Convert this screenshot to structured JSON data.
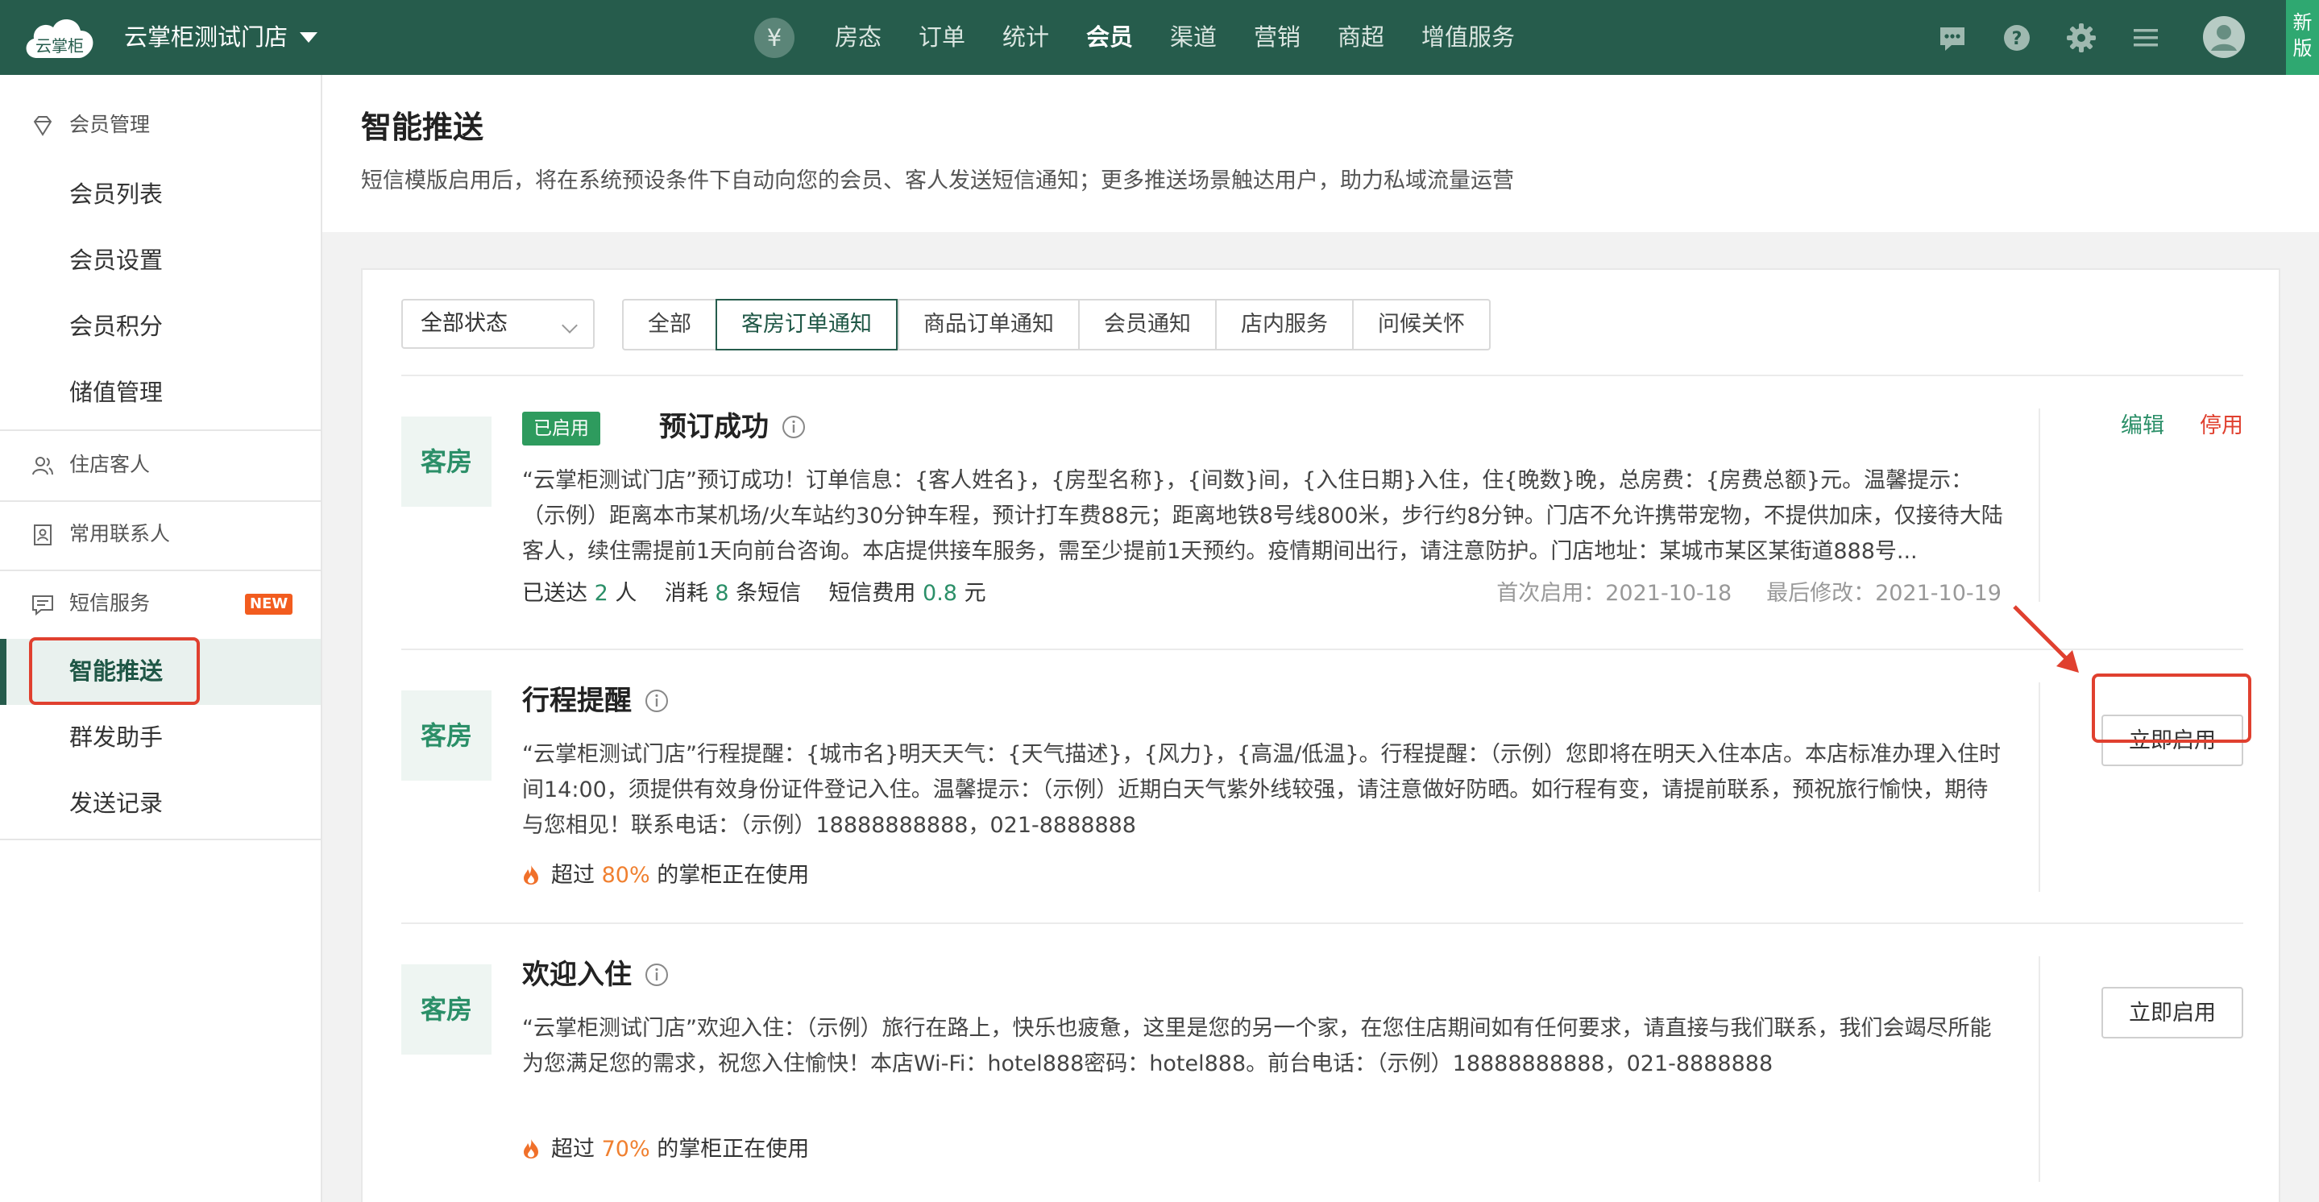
{
  "topbar": {
    "logo_text": "云掌柜",
    "store_name": "云掌柜测试门店",
    "yen_symbol": "¥",
    "nav": [
      "房态",
      "订单",
      "统计",
      "会员",
      "渠道",
      "营销",
      "商超",
      "增值服务"
    ],
    "active_nav": "会员",
    "icons": [
      "message-icon",
      "help-icon",
      "settings-icon",
      "menu-icon",
      "user-avatar-icon"
    ],
    "new_version_label": "新版"
  },
  "sidebar": {
    "member_mgmt": {
      "label": "会员管理",
      "items": [
        "会员列表",
        "会员设置",
        "会员积分",
        "储值管理"
      ]
    },
    "guests": {
      "label": "住店客人"
    },
    "contacts": {
      "label": "常用联系人"
    },
    "sms": {
      "label": "短信服务",
      "new_tag": "NEW",
      "items": [
        "智能推送",
        "群发助手",
        "发送记录"
      ],
      "active_item": "智能推送"
    }
  },
  "page": {
    "title": "智能推送",
    "description": "短信模版启用后，将在系统预设条件下自动向您的会员、客人发送短信通知；更多推送场景触达用户，助力私域流量运营"
  },
  "filters": {
    "status_select": "全部状态",
    "tabs": [
      "全部",
      "客房订单通知",
      "商品订单通知",
      "会员通知",
      "店内服务",
      "问候关怀"
    ],
    "active_tab": "客房订单通知"
  },
  "templates": [
    {
      "type_label": "客房",
      "enabled_badge": "已启用",
      "name": "预订成功",
      "content": "“云掌柜测试门店”预订成功！订单信息：{客人姓名}，{房型名称}，{间数}间，{入住日期}入住，住{晚数}晚，总房费：{房费总额}元。温馨提示：（示例）距离本市某机场/火车站约30分钟车程，预计打车费88元；距离地铁8号线800米，步行约8分钟。门店不允许携带宠物，不提供加床，仅接待大陆客人，续住需提前1天向前台咨询。本店提供接车服务，需至少提前1天预约。疫情期间出行，请注意防护。门店地址：某城市某区某街道888号...",
      "stats": {
        "sent_label": "已送达",
        "sent_count": "2",
        "sent_unit": "人",
        "consume_label": "消耗",
        "consume_count": "8",
        "consume_unit": "条短信",
        "fee_label": "短信费用",
        "fee_value": "0.8",
        "fee_unit": "元"
      },
      "first_enabled": "首次启用：2021-10-18",
      "last_modified": "最后修改：2021-10-19",
      "edit_label": "编辑",
      "disable_label": "停用"
    },
    {
      "type_label": "客房",
      "name": "行程提醒",
      "content": "“云掌柜测试门店”行程提醒：{城市名}明天天气：{天气描述}，{风力}，{高温/低温}。行程提醒：（示例）您即将在明天入住本店。本店标准办理入住时间14:00，须提供有效身份证件登记入住。温馨提示：（示例）近期白天气紫外线较强，请注意做好防晒。如行程有变，请提前联系，预祝旅行愉快，期待与您相见！联系电话：（示例）18888888888，021-8888888",
      "usage_prefix": "超过",
      "usage_pct": "80%",
      "usage_suffix": "的掌柜正在使用",
      "enable_label": "立即启用"
    },
    {
      "type_label": "客房",
      "name": "欢迎入住",
      "content": "“云掌柜测试门店”欢迎入住：（示例）旅行在路上，快乐也疲惫，这里是您的另一个家，在您住店期间如有任何要求，请直接与我们联系，我们会竭尽所能为您满足您的需求，祝您入住愉快！本店Wi-Fi：hotel888密码：hotel888。前台电话：（示例）18888888888，021-8888888",
      "usage_prefix": "超过",
      "usage_pct": "70%",
      "usage_suffix": "的掌柜正在使用",
      "enable_label": "立即启用"
    }
  ],
  "colors": {
    "topbar": "#265c4c",
    "accent_green": "#2b8f68",
    "badge_green": "#2e9b5e",
    "warning_red": "#e0402f",
    "usage_orange": "#f08030"
  }
}
